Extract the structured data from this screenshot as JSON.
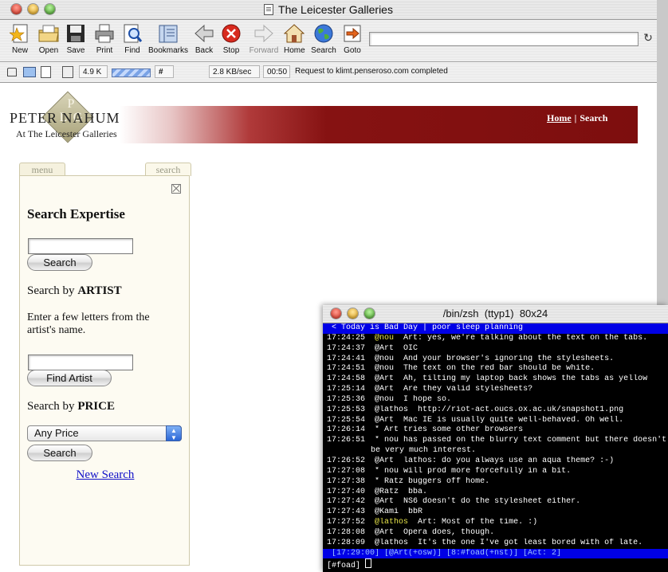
{
  "browser": {
    "title": "The Leicester Galleries",
    "toolbar": [
      {
        "label": "New",
        "icon": "new-star-icon",
        "enabled": true
      },
      {
        "label": "Open",
        "icon": "folder-icon",
        "enabled": true
      },
      {
        "label": "Save",
        "icon": "disk-icon",
        "enabled": true
      },
      {
        "label": "Print",
        "icon": "printer-icon",
        "enabled": true
      },
      {
        "label": "Find",
        "icon": "find-icon",
        "enabled": true
      },
      {
        "label": "Bookmarks",
        "icon": "bookmarks-icon",
        "enabled": true
      },
      {
        "label": "Back",
        "icon": "back-arrow-icon",
        "enabled": true
      },
      {
        "label": "Stop",
        "icon": "stop-icon",
        "enabled": true
      },
      {
        "label": "Forward",
        "icon": "forward-arrow-icon",
        "enabled": false
      },
      {
        "label": "Home",
        "icon": "home-icon",
        "enabled": true
      },
      {
        "label": "Search",
        "icon": "globe-icon",
        "enabled": true
      },
      {
        "label": "Goto",
        "icon": "goto-icon",
        "enabled": true
      }
    ],
    "url_value": "",
    "status": {
      "size": "4.9 K",
      "rate": "2.8 KB/sec",
      "time": "00:50",
      "message": "Request to klimt.penseroso.com completed"
    }
  },
  "page": {
    "logo_name": "PETER NAHUM",
    "logo_sub": "At The Leicester Galleries",
    "logo_monogram": "P\nL G",
    "nav": {
      "home": "Home",
      "sep": "|",
      "search": "Search"
    },
    "tabs": {
      "menu": "menu",
      "search": "search"
    },
    "search_expertise": "Search Expertise",
    "search_button": "Search",
    "by_artist_prefix": "Search by ",
    "by_artist_strong": "ARTIST",
    "artist_hint": "Enter a few letters from the artist's name.",
    "find_artist_button": "Find Artist",
    "by_price_prefix": "Search by ",
    "by_price_strong": "PRICE",
    "price_selected": "Any Price",
    "new_search": "New Search"
  },
  "terminal": {
    "title": "/bin/zsh  (ttyp1)  80x24",
    "topic": " < Today is Bad Day | poor sleep planning",
    "lines": [
      {
        "time": "17:24:25",
        "nick": "@nou",
        "nick_color": "yellow",
        "text": "  Art: yes, we're talking about the text on the tabs."
      },
      {
        "time": "17:24:37",
        "nick": "@Art",
        "text": "  OIC"
      },
      {
        "time": "17:24:41",
        "nick": "@nou",
        "text": "  And your browser's ignoring the stylesheets."
      },
      {
        "time": "17:24:51",
        "nick": "@nou",
        "text": "  The text on the red bar should be white."
      },
      {
        "time": "17:24:58",
        "nick": "@Art",
        "text": "  Ah, tilting my laptop back shows the tabs as yellow"
      },
      {
        "time": "17:25:14",
        "nick": "@Art",
        "text": "  Are they valid stylesheets?"
      },
      {
        "time": "17:25:36",
        "nick": "@nou",
        "text": "  I hope so."
      },
      {
        "time": "17:25:53",
        "nick": "@lathos",
        "text": "  http://riot-act.oucs.ox.ac.uk/snapshot1.png"
      },
      {
        "time": "17:25:54",
        "nick": "@Art",
        "text": "  Mac IE is usually quite well-behaved. Oh well."
      },
      {
        "time": "17:26:14",
        "nick": "*",
        "text": " Art tries some other browsers"
      },
      {
        "time": "17:26:51",
        "nick": "*",
        "text": " nou has passed on the blurry text comment but there doesn't"
      },
      {
        "time": "",
        "nick": "",
        "text": "be very much interest."
      },
      {
        "time": "17:26:52",
        "nick": "@Art",
        "text": "  lathos: do you always use an aqua theme? :-)"
      },
      {
        "time": "17:27:08",
        "nick": "*",
        "text": " nou will prod more forcefully in a bit."
      },
      {
        "time": "17:27:38",
        "nick": "*",
        "text": " Ratz buggers off home."
      },
      {
        "time": "17:27:40",
        "nick": "@Ratz",
        "text": "  bba."
      },
      {
        "time": "17:27:42",
        "nick": "@Art",
        "text": "  NS6 doesn't do the stylesheet either."
      },
      {
        "time": "17:27:43",
        "nick": "@Kami",
        "text": "  bbR"
      },
      {
        "time": "17:27:52",
        "nick": "@lathos",
        "nick_color": "yellow",
        "text": "  Art: Most of the time. :)"
      },
      {
        "time": "17:28:08",
        "nick": "@Art",
        "text": "  Opera does, though."
      },
      {
        "time": "17:28:09",
        "nick": "@lathos",
        "text": "  It's the one I've got least bored with of late."
      }
    ],
    "status_line": " [17:29:00] [@Art(+osw)] [8:#foad(+nst)] [Act: 2]",
    "prompt": "[#foad] "
  }
}
